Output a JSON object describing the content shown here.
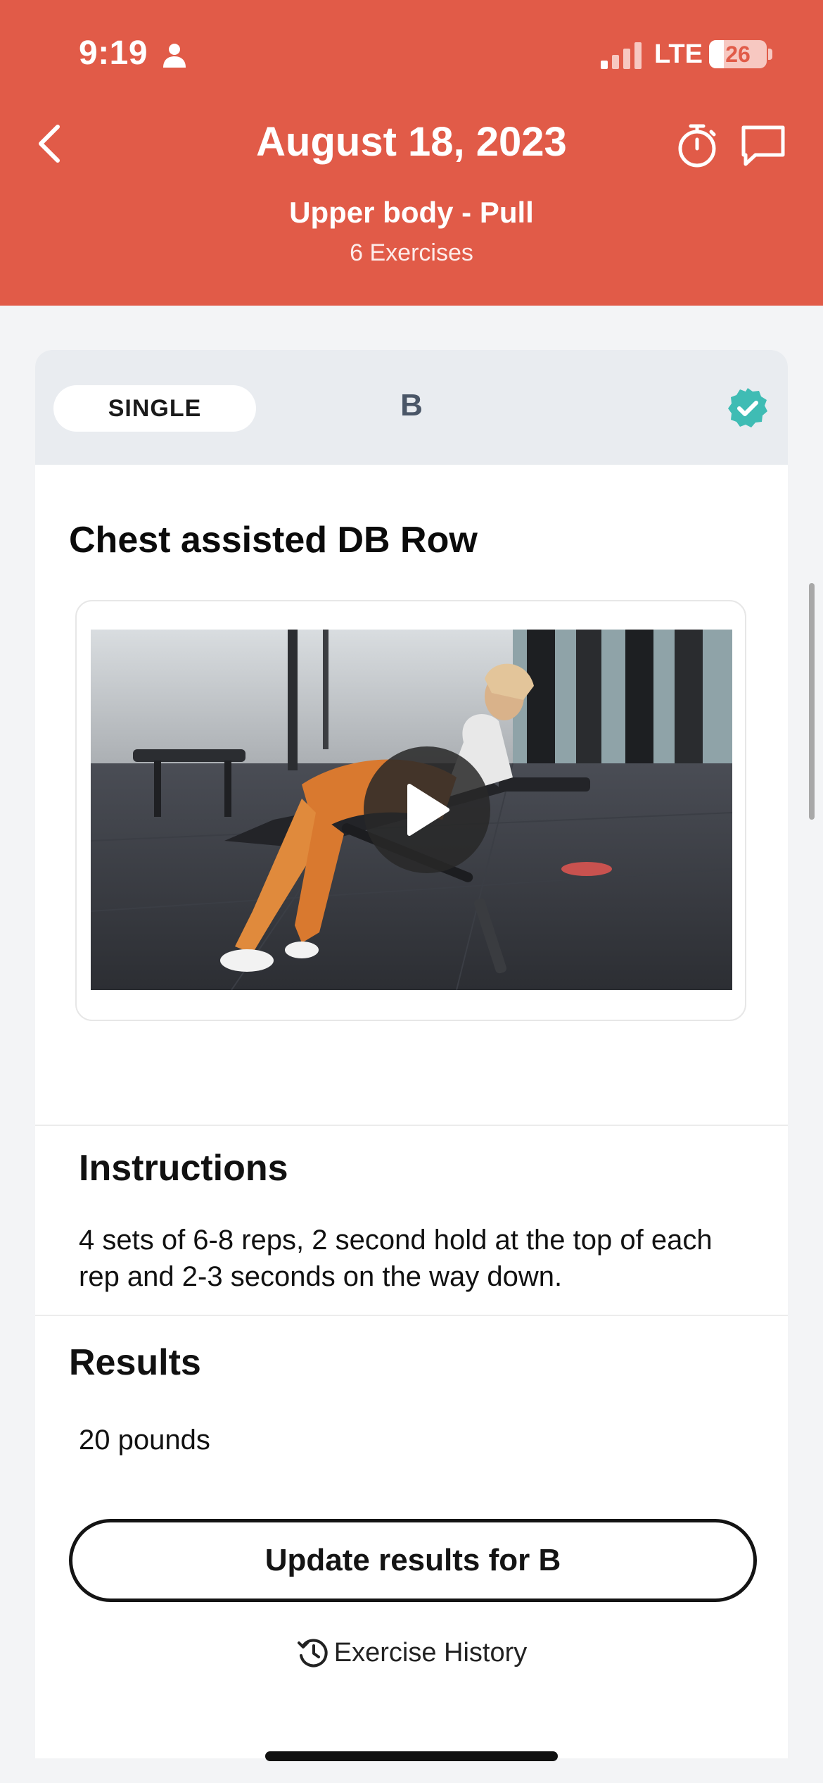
{
  "status_bar": {
    "time": "9:19",
    "network": "LTE",
    "battery_level": "26",
    "battery_fraction": 0.26
  },
  "header": {
    "title": "August 18, 2023",
    "subtitle": "Upper body - Pull",
    "exercise_count": "6 Exercises",
    "background_color": "#e15b48"
  },
  "card": {
    "type_label": "SINGLE",
    "group_label": "B",
    "completed": true,
    "accent_color": "#3fbcb4",
    "exercise_name": "Chest assisted DB Row",
    "instructions_title": "Instructions",
    "instructions_text": "4 sets of 6-8 reps, 2 second hold at the top of each rep and 2-3 seconds on the way down.",
    "results_title": "Results",
    "results_value": "20 pounds",
    "update_button_label": "Update results for B",
    "history_label": "Exercise History"
  }
}
